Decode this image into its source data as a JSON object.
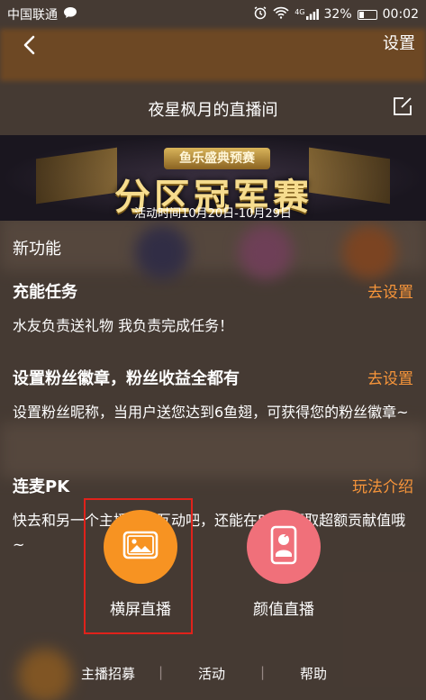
{
  "status_bar": {
    "carrier": "中国联通",
    "battery": "32%",
    "battery_level": 0.32,
    "time": "00:02",
    "network": "4G"
  },
  "top_bar": {
    "settings_label": "设置"
  },
  "room_title": "夜星枫月的直播间",
  "banner": {
    "top_badge": "鱼乐盛典预赛",
    "main_text": "分区冠军赛",
    "date_text": "活动时间10月20日-10月29日"
  },
  "section_label": "新功能",
  "features": [
    {
      "title": "充能任务",
      "link": "去设置",
      "desc": "水友负责送礼物 我负责完成任务！"
    },
    {
      "title": "设置粉丝徽章，粉丝收益全都有",
      "link": "去设置",
      "desc": "设置粉丝昵称，当用户送您达到6鱼翅，可获得您的粉丝徽章~"
    },
    {
      "title": "连麦PK",
      "link": "玩法介绍",
      "desc": "快去和另一个主播连麦互动吧，还能在PK中赢取超额贡献值哦~"
    }
  ],
  "actions": {
    "landscape_label": "横屏直播",
    "beauty_label": "颜值直播"
  },
  "footer": {
    "items": [
      "主播招募",
      "活动",
      "帮助"
    ]
  },
  "colors": {
    "accent_orange": "#f7953a",
    "landscape_circle": "#f79322",
    "beauty_circle": "#f0707a",
    "highlight": "#e0221b"
  }
}
